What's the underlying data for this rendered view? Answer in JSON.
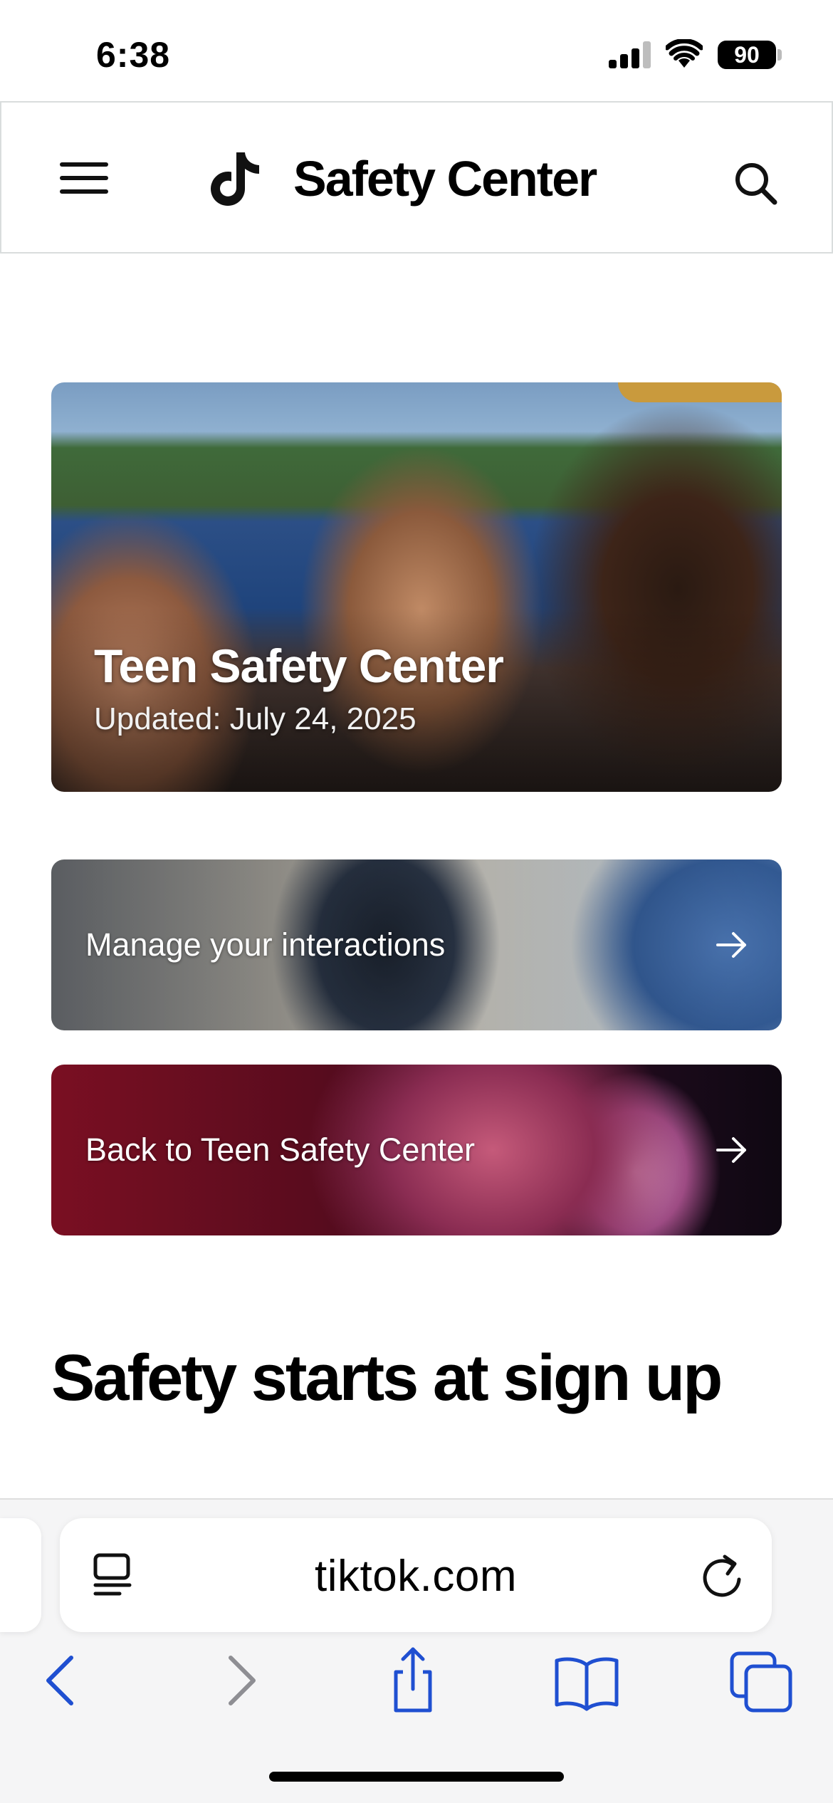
{
  "status_bar": {
    "time": "6:38",
    "battery": "90"
  },
  "header": {
    "menu_icon": "hamburger-menu-icon",
    "logo_icon": "tiktok-logo-icon",
    "title": "Safety Center",
    "search_icon": "search-icon"
  },
  "hero": {
    "title": "Teen Safety Center",
    "updated": "Updated: July 24, 2025"
  },
  "cards": [
    {
      "label": "Manage your interactions",
      "icon": "arrow-right-icon"
    },
    {
      "label": "Back to Teen Safety Center",
      "icon": "arrow-right-icon"
    }
  ],
  "section": {
    "heading": "Safety starts at sign up"
  },
  "browser": {
    "address": "tiktok.com",
    "reader_icon": "reader-mode-icon",
    "reload_icon": "reload-icon",
    "toolbar": [
      "back-icon",
      "forward-icon",
      "share-icon",
      "bookmarks-icon",
      "tabs-icon"
    ],
    "accent_color": "#1f4fd1",
    "disabled_color": "#8e8e93"
  }
}
